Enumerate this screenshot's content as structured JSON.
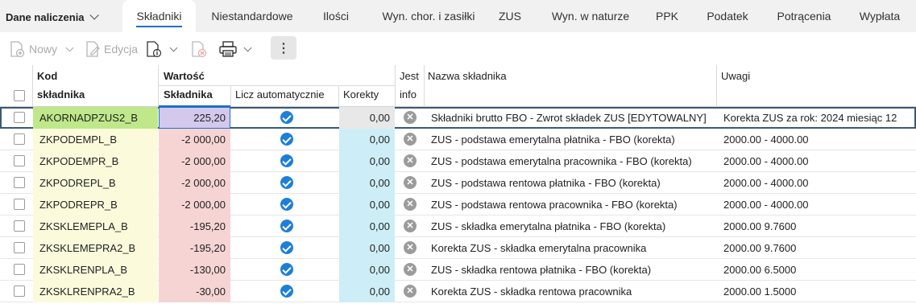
{
  "tabs": {
    "dropdown_label": "Dane naliczenia",
    "items": [
      "Składniki",
      "Niestandardowe",
      "Ilości",
      "Wyn. chor. i zasiłki",
      "ZUS",
      "Wyn. w naturze",
      "PPK",
      "Podatek",
      "Potrącenia",
      "Wypłata"
    ],
    "active": "Składniki"
  },
  "toolbar": {
    "new_label": "Nowy",
    "edit_label": "Edycja",
    "more_label": "⋮"
  },
  "table": {
    "headers": {
      "kod_line1": "Kod",
      "kod_line2": "składnika",
      "wartosc": "Wartość",
      "skladnika": "Składnika",
      "licz": "Licz automatycznie",
      "korekty": "Korekty",
      "jest_line1": "Jest",
      "jest_line2": "info",
      "nazwa": "Nazwa składnika",
      "uwagi": "Uwagi"
    },
    "rows": [
      {
        "kod": "AKORNADPZUS2_B",
        "wartosc": "225,20",
        "licz": true,
        "korekty": "0,00",
        "jest_info": false,
        "nazwa": "Składniki brutto FBO - Zwrot składek ZUS [EDYTOWALNY]",
        "uwagi": "Korekta ZUS za rok: 2024 miesiąc 12",
        "selected": true
      },
      {
        "kod": "ZKPODEMPL_B",
        "wartosc": "-2 000,00",
        "licz": true,
        "korekty": "0,00",
        "jest_info": false,
        "nazwa": "ZUS - podstawa emerytalna płatnika - FBO (korekta)",
        "uwagi": "2000.00 - 4000.00",
        "selected": false
      },
      {
        "kod": "ZKPODEMPR_B",
        "wartosc": "-2 000,00",
        "licz": true,
        "korekty": "0,00",
        "jest_info": false,
        "nazwa": "ZUS - podstawa emerytalna pracownika - FBO (korekta)",
        "uwagi": "2000.00 - 4000.00",
        "selected": false
      },
      {
        "kod": "ZKPODREPL_B",
        "wartosc": "-2 000,00",
        "licz": true,
        "korekty": "0,00",
        "jest_info": false,
        "nazwa": "ZUS - podstawa rentowa płatnika - FBO (korekta)",
        "uwagi": "2000.00 - 4000.00",
        "selected": false
      },
      {
        "kod": "ZKPODREPR_B",
        "wartosc": "-2 000,00",
        "licz": true,
        "korekty": "0,00",
        "jest_info": false,
        "nazwa": "ZUS - podstawa rentowa pracownika - FBO (korekta)",
        "uwagi": "2000.00 - 4000.00",
        "selected": false
      },
      {
        "kod": "ZKSKLEMEPLA_B",
        "wartosc": "-195,20",
        "licz": true,
        "korekty": "0,00",
        "jest_info": false,
        "nazwa": "ZUS - składka emerytalna płatnika - FBO (korekta)",
        "uwagi": "2000.00 9.7600",
        "selected": false
      },
      {
        "kod": "ZKSKLEMEPRA2_B",
        "wartosc": "-195,20",
        "licz": true,
        "korekty": "0,00",
        "jest_info": false,
        "nazwa": "Korekta ZUS - składka emerytalna pracownika",
        "uwagi": "2000.00 9.7600",
        "selected": false
      },
      {
        "kod": "ZKSKLRENPLA_B",
        "wartosc": "-130,00",
        "licz": true,
        "korekty": "0,00",
        "jest_info": false,
        "nazwa": "ZUS - składka rentowa płatnika - FBO (korekta)",
        "uwagi": "2000.00 6.5000",
        "selected": false
      },
      {
        "kod": "ZKSKLRENPRA2_B",
        "wartosc": "-30,00",
        "licz": true,
        "korekty": "0,00",
        "jest_info": false,
        "nazwa": "Korekta ZUS - składka rentowa pracownika",
        "uwagi": "2000.00 1.5000",
        "selected": false
      }
    ]
  },
  "colors": {
    "kod_bg": "#fbfbdc",
    "kod_selected_bg": "#bfe88a",
    "wartosc_bg": "#f6d4d4",
    "wartosc_selected_bg": "#d4c8ec",
    "korekty_bg": "#cdeef6",
    "check": "#1e7fd6",
    "tab_underline": "#1f6fc5"
  }
}
